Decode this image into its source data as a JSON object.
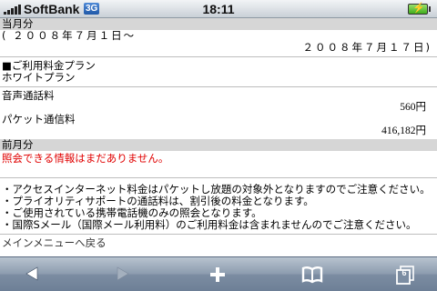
{
  "status_bar": {
    "carrier": "SoftBank",
    "network": "3G",
    "time": "18:11"
  },
  "current": {
    "header": "当月分",
    "period_start": "( ２００８年７月１日～",
    "period_end": "２００８年７月１７日)",
    "plan_label": "■ご利用料金プラン",
    "plan_value": "ホワイトプラン",
    "voice_label": "音声通話料",
    "voice_amount": "560円",
    "packet_label": "パケット通信料",
    "packet_amount": "416,182円"
  },
  "previous": {
    "header": "前月分",
    "message": "照会できる情報はまだありません。"
  },
  "notes": [
    "・アクセスインターネット料金はパケットし放題の対象外となりますのでご注意ください。",
    "・プライオリティサポートの通話料は、割引後の料金となります。",
    "・ご使用されている携帯電話機のみの照会となります。",
    "・国際Sメール（国際メール利用料）のご利用料金は含まれませんのでご注意ください。"
  ],
  "menu_link": "メインメニューへ戻る",
  "toolbar": {
    "pages_count": "6",
    "icons": [
      "back-icon",
      "forward-icon",
      "add-icon",
      "bookmarks-icon",
      "pages-icon"
    ]
  }
}
